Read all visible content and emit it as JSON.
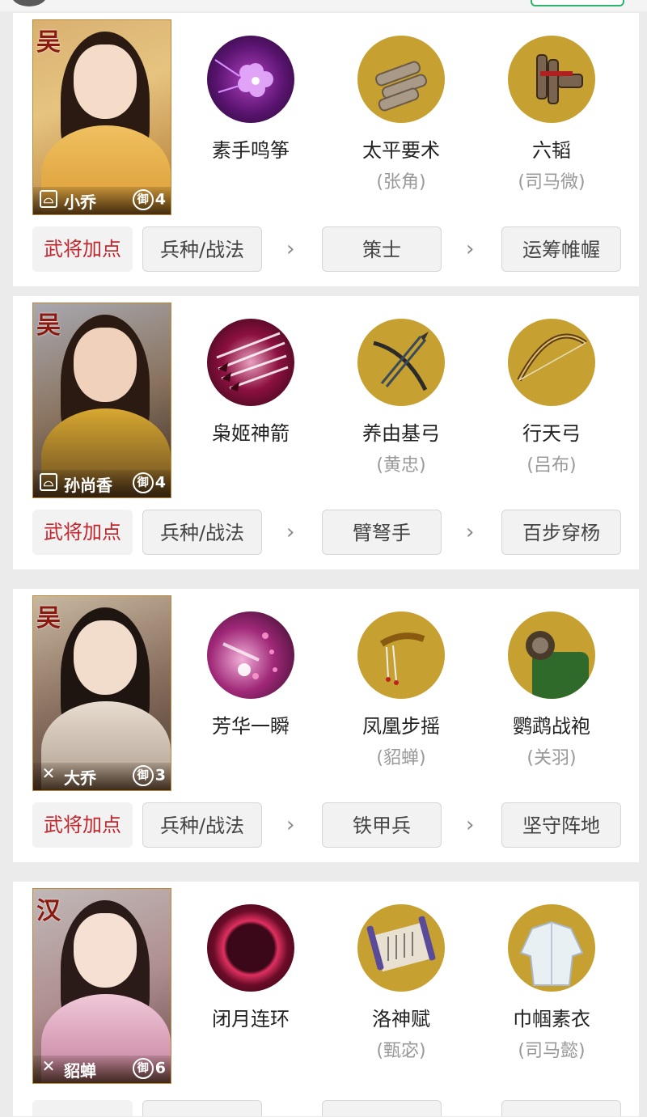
{
  "row_tag": "武将加点",
  "cards": [
    {
      "faction": "吴",
      "hero": "小乔",
      "rank_label": "御",
      "rank": "4",
      "class": "bow",
      "skill": {
        "name": "素手鸣筝",
        "owner": ""
      },
      "item1": {
        "name": "太平要术",
        "owner": "(张角)"
      },
      "item2": {
        "name": "六韬",
        "owner": "(司马微)"
      },
      "path": [
        "兵种/战法",
        "策士",
        "运筹帷幄"
      ]
    },
    {
      "faction": "吴",
      "hero": "孙尚香",
      "rank_label": "御",
      "rank": "4",
      "class": "bow",
      "skill": {
        "name": "枭姬神箭",
        "owner": ""
      },
      "item1": {
        "name": "养由基弓",
        "owner": "(黄忠)"
      },
      "item2": {
        "name": "行天弓",
        "owner": "(吕布)"
      },
      "path": [
        "兵种/战法",
        "臂弩手",
        "百步穿杨"
      ]
    },
    {
      "faction": "吴",
      "hero": "大乔",
      "rank_label": "御",
      "rank": "3",
      "class": "crossed",
      "skill": {
        "name": "芳华一瞬",
        "owner": ""
      },
      "item1": {
        "name": "凤凰步摇",
        "owner": "(貂蝉)"
      },
      "item2": {
        "name": "鹦鹉战袍",
        "owner": "(关羽)"
      },
      "path": [
        "兵种/战法",
        "铁甲兵",
        "坚守阵地"
      ]
    },
    {
      "faction": "汉",
      "hero": "貂蝉",
      "rank_label": "御",
      "rank": "6",
      "class": "crossed",
      "skill": {
        "name": "闭月连环",
        "owner": ""
      },
      "item1": {
        "name": "洛神赋",
        "owner": "(甄宓)"
      },
      "item2": {
        "name": "巾帼素衣",
        "owner": "(司马懿)"
      },
      "path": []
    }
  ],
  "colors": {
    "tag_text": "#c0262c",
    "gold_circle": "#c6a030",
    "background": "#ebebeb"
  },
  "icons": [
    "bow-class-icon",
    "crossed-swords-class-icon",
    "arrow-right-icon"
  ]
}
